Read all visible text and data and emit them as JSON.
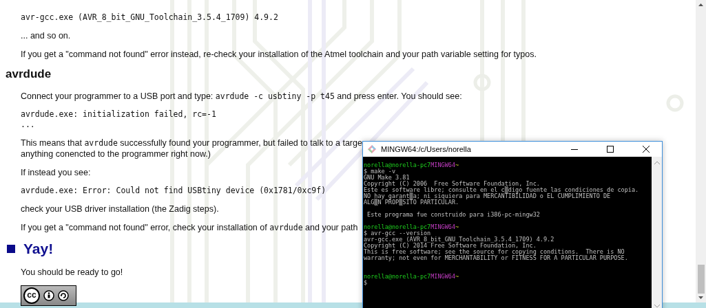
{
  "page": {
    "blocks": [
      {
        "kind": "code",
        "lines": [
          "avr-gcc.exe (AVR_8_bit_GNU_Toolchain_3.5.4_1709) 4.9.2"
        ]
      },
      {
        "kind": "para",
        "segments": [
          {
            "text": "... and so on.",
            "code": false
          }
        ]
      },
      {
        "kind": "para",
        "segments": [
          {
            "text": "If you get a \"command not found\" error instead, re-check your installation of the Atmel toolchain and your path variable setting for typos.",
            "code": false
          }
        ]
      },
      {
        "kind": "heading",
        "text": "avrdude"
      },
      {
        "kind": "para",
        "segments": [
          {
            "text": "Connect your programmer to a USB port and type: ",
            "code": false
          },
          {
            "text": "avrdude -c usbtiny -p t45",
            "code": true
          },
          {
            "text": " and press enter. You should see:",
            "code": false
          }
        ]
      },
      {
        "kind": "code",
        "lines": [
          "avrdude.exe: initialization failed, rc=-1",
          "..."
        ]
      },
      {
        "kind": "para",
        "segments": [
          {
            "text": "This means that ",
            "code": false
          },
          {
            "text": "avrdude",
            "code": true
          },
          {
            "text": " successfully found your programmer, but failed to talk to a targe",
            "code": false
          }
        ]
      },
      {
        "kind": "para_tail",
        "segments": [
          {
            "text": "anything conencted to the programmer right now.)",
            "code": false
          }
        ]
      },
      {
        "kind": "para",
        "segments": [
          {
            "text": "If instead you see:",
            "code": false
          }
        ]
      },
      {
        "kind": "code",
        "lines": [
          "avrdude.exe: Error: Could not find USBtiny device (0x1781/0xc9f)"
        ]
      },
      {
        "kind": "para",
        "segments": [
          {
            "text": "check your USB driver installation (the Zadig steps).",
            "code": false
          }
        ]
      },
      {
        "kind": "para",
        "segments": [
          {
            "text": "If you get a \"command not found\" error, check your installation of ",
            "code": false
          },
          {
            "text": "avrdude",
            "code": true
          },
          {
            "text": " and your path",
            "code": false
          }
        ]
      },
      {
        "kind": "section",
        "text": "Yay!"
      },
      {
        "kind": "para",
        "segments": [
          {
            "text": "You should be ready to go!",
            "code": false
          }
        ]
      },
      {
        "kind": "license",
        "label": "cc"
      }
    ]
  },
  "terminal": {
    "title": "MINGW64:/c/Users/norella",
    "lines": [
      {
        "kind": "prompt",
        "user": "norella@norella-pc7",
        "shell": "MINGW64",
        "dir": "~"
      },
      {
        "kind": "out",
        "text": "$ make -v"
      },
      {
        "kind": "out",
        "text": "GNU Make 3.81"
      },
      {
        "kind": "out",
        "text": "Copyright (C) 2006  Free Software Foundation, Inc."
      },
      {
        "kind": "out",
        "text": "Este es software libre; consulte en el c▒digo fuente las condiciones de copia."
      },
      {
        "kind": "out",
        "text": "NO hay garant▒a; ni siquiera para MERCANTIBILIDAD o EL CUMPLIMIENTO DE"
      },
      {
        "kind": "out",
        "text": "ALG▒N PROP▒SITO PARTICULAR."
      },
      {
        "kind": "blank"
      },
      {
        "kind": "out",
        "text": " Este programa fue construido para i386-pc-mingw32"
      },
      {
        "kind": "blank"
      },
      {
        "kind": "prompt",
        "user": "norella@norella-pc7",
        "shell": "MINGW64",
        "dir": "~"
      },
      {
        "kind": "out",
        "text": "$ avr-gcc --version"
      },
      {
        "kind": "out",
        "text": "avr-gcc.exe (AVR_8_bit_GNU_Toolchain_3.5.4_1709) 4.9.2"
      },
      {
        "kind": "out",
        "text": "Copyright (C) 2014 Free Software Foundation, Inc."
      },
      {
        "kind": "out",
        "text": "This is free software; see the source for copying conditions.  There is NO"
      },
      {
        "kind": "out",
        "text": "warranty; not even for MERCHANTABILITY or FITNESS FOR A PARTICULAR PURPOSE."
      },
      {
        "kind": "blank"
      },
      {
        "kind": "blank"
      },
      {
        "kind": "prompt",
        "user": "norella@norella-pc7",
        "shell": "MINGW64",
        "dir": "~"
      },
      {
        "kind": "out",
        "text": "$"
      }
    ]
  }
}
